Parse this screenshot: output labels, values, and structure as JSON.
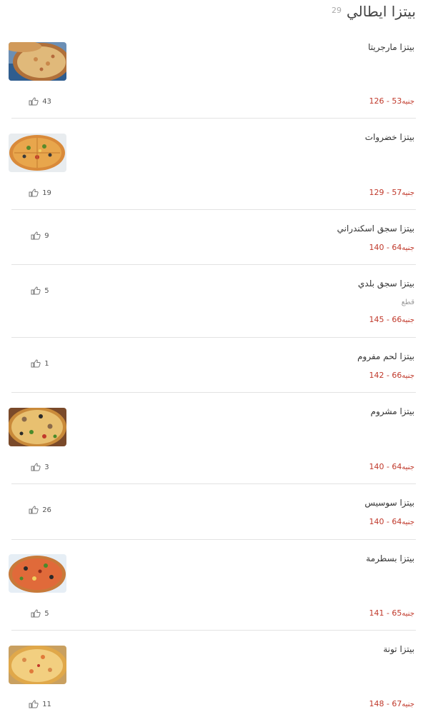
{
  "header": {
    "title": "بيتزا ايطالي",
    "count": "29"
  },
  "currency": "جنيه",
  "items": [
    {
      "name": "بيتزا مارجريتا",
      "price": "53 - 126",
      "likes": "43",
      "image": "margherita-pizza-photo"
    },
    {
      "name": "بيتزا خضروات",
      "price": "57 - 129",
      "likes": "19",
      "image": "vegetable-pizza-photo"
    },
    {
      "name": "بيتزا سجق اسكندراني",
      "price": "64 - 140",
      "likes": "9"
    },
    {
      "name": "بيتزا سجق بلدي",
      "subtitle": "قطع",
      "price": "66 - 145",
      "likes": "5"
    },
    {
      "name": "بيتزا لحم مفروم",
      "price": "66 - 142",
      "likes": "1"
    },
    {
      "name": "بيتزا مشروم",
      "price": "64 - 140",
      "likes": "3",
      "image": "mushroom-pizza-photo"
    },
    {
      "name": "بيتزا سوسيس",
      "price": "64 - 140",
      "likes": "26"
    },
    {
      "name": "بيتزا بسطرمة",
      "price": "65 - 141",
      "likes": "5",
      "image": "pastrami-pizza-photo"
    },
    {
      "name": "بيتزا تونة",
      "price": "67 - 148",
      "likes": "11",
      "image": "tuna-pizza-photo"
    }
  ],
  "colors": {
    "price": "#c0392b",
    "divider": "#e3e3e3",
    "title": "#444444"
  },
  "icons": {
    "like": "thumbs-up-icon"
  }
}
